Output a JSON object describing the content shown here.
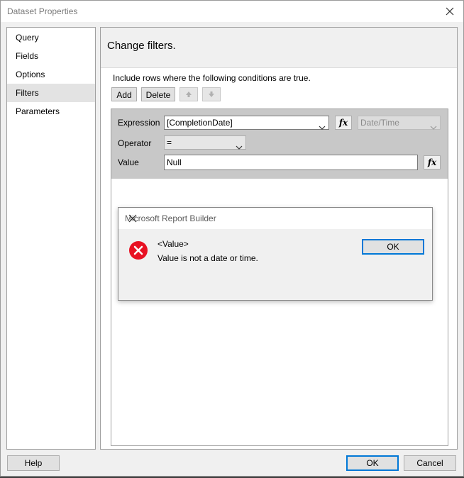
{
  "dialog": {
    "title": "Dataset Properties",
    "nav": [
      {
        "label": "Query"
      },
      {
        "label": "Fields"
      },
      {
        "label": "Options"
      },
      {
        "label": "Filters",
        "selected": true
      },
      {
        "label": "Parameters"
      }
    ],
    "header": "Change filters.",
    "intro": "Include rows where the following conditions are true.",
    "toolbar": {
      "add_label": "Add",
      "delete_label": "Delete",
      "up_icon": "arrow-up-icon",
      "down_icon": "arrow-down-icon"
    },
    "filter": {
      "expression_label": "Expression",
      "expression_value": "[CompletionDate]",
      "type_value": "Date/Time",
      "operator_label": "Operator",
      "operator_value": "=",
      "value_label": "Value",
      "value_value": "Null",
      "fx_label": "fx"
    },
    "footer": {
      "help_label": "Help",
      "ok_label": "OK",
      "cancel_label": "Cancel"
    }
  },
  "message_box": {
    "title": "Microsoft Report Builder",
    "heading": "<Value>",
    "message": "Value is not a date or time.",
    "ok_label": "OK",
    "icon": "error-icon"
  },
  "colors": {
    "accent": "#0078d7",
    "error": "#e81123"
  }
}
